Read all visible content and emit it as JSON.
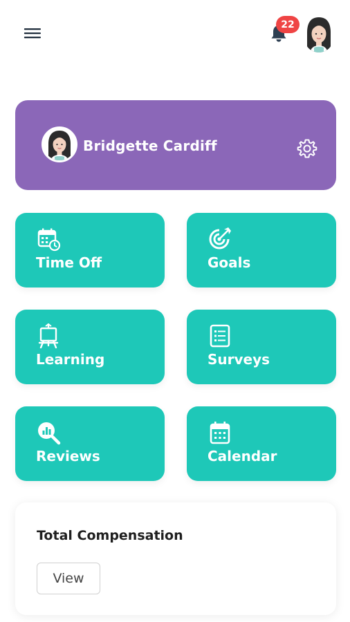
{
  "header": {
    "menu_icon": "hamburger-menu-icon",
    "notifications": {
      "icon": "bell-icon",
      "count": "22"
    },
    "avatar_icon": "user-avatar"
  },
  "profile": {
    "name": "Bridgette Cardiff",
    "settings_icon": "gear-icon"
  },
  "tiles": [
    {
      "label": "Time Off",
      "icon": "calendar-clock-icon"
    },
    {
      "label": "Goals",
      "icon": "target-icon"
    },
    {
      "label": "Learning",
      "icon": "easel-icon"
    },
    {
      "label": "Surveys",
      "icon": "list-document-icon"
    },
    {
      "label": "Reviews",
      "icon": "magnifier-chart-icon"
    },
    {
      "label": "Calendar",
      "icon": "calendar-icon"
    }
  ],
  "compensation": {
    "title": "Total Compensation",
    "button_label": "View"
  },
  "colors": {
    "profile_card": "#8b67b8",
    "tile": "#1ec8b8",
    "badge": "#ef4444"
  }
}
